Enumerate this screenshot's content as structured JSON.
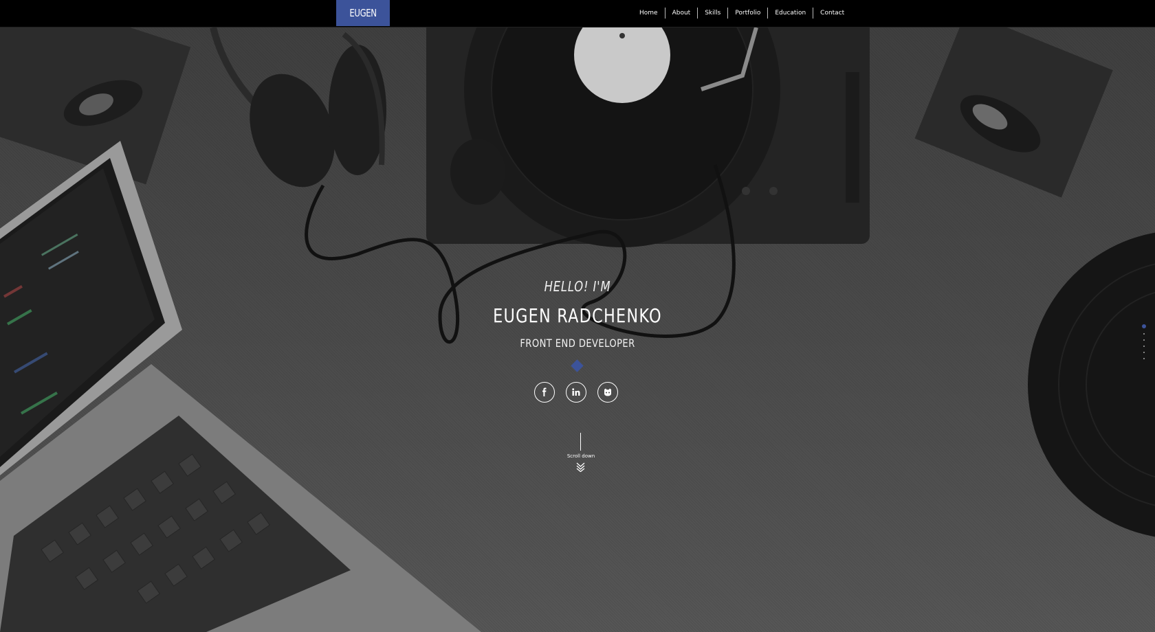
{
  "nav": {
    "brand": "EUGEN",
    "items": [
      {
        "label": "Home"
      },
      {
        "label": "About"
      },
      {
        "label": "Skills"
      },
      {
        "label": "Portfolio"
      },
      {
        "label": "Education"
      },
      {
        "label": "Contact"
      }
    ]
  },
  "hero": {
    "greeting": "HELLO! I'M",
    "name": "EUGEN RADCHENKO",
    "role": "FRONT END DEVELOPER",
    "scroll_label": "Scroll down",
    "socials": [
      {
        "icon": "facebook-icon"
      },
      {
        "icon": "linkedin-icon"
      },
      {
        "icon": "github-icon"
      }
    ]
  },
  "side_nav": {
    "dot_count": 6,
    "active_index": 0
  },
  "colors": {
    "accent": "#3c539a",
    "navbar": "#000000",
    "background": "#4a4a4a"
  }
}
